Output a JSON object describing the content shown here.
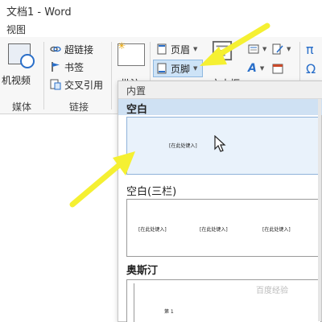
{
  "window": {
    "title": "文档1 - Word"
  },
  "menu": {
    "view_label": "视图"
  },
  "ribbon": {
    "media": {
      "video_label": "机视频",
      "group_label": "媒体"
    },
    "links": {
      "hyperlink_label": "超链接",
      "bookmark_label": "书签",
      "crossref_label": "交叉引用",
      "group_label": "链接"
    },
    "comment": {
      "label": "批注"
    },
    "header_footer": {
      "header_label": "页眉",
      "footer_label": "页脚",
      "textbox_label": "文本框"
    },
    "symbols": {
      "pi": "π",
      "omega": "Ω"
    }
  },
  "dropdown": {
    "header": "内置",
    "blank": {
      "label": "空白",
      "placeholder": "[在此处键入]"
    },
    "blank3": {
      "label": "空白(三栏)",
      "placeholders": [
        "[在此处键入]",
        "[在此处键入]",
        "[在此处键入]"
      ]
    },
    "austin": {
      "label": "奥斯汀",
      "page_text": "第 1"
    }
  },
  "colors": {
    "highlight": "#cfe1f3",
    "footer_button": "#cde3f7",
    "arrow": "#f5f032"
  },
  "watermark": "百度经验"
}
